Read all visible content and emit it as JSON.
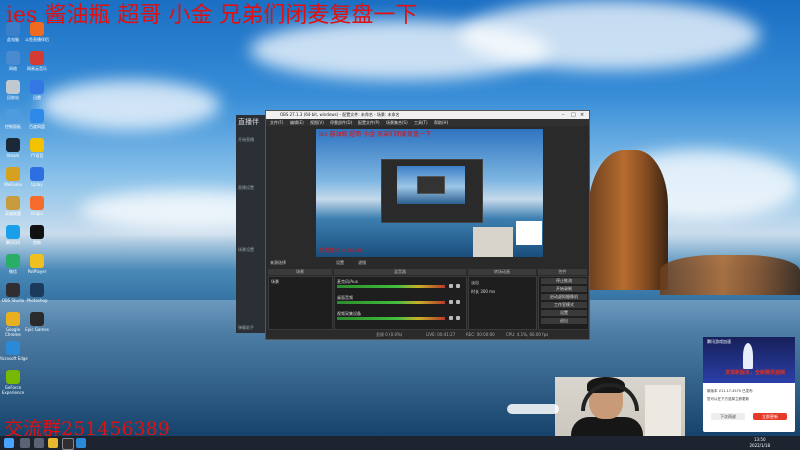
{
  "overlay": {
    "title": "ies 酱油瓶 超哥 小金 兄弟们闭麦复盘一下",
    "group": "交流群251456389"
  },
  "desktop_icons": [
    {
      "label": "此电脑",
      "color": "#3a7fc8"
    },
    {
      "label": "网络",
      "color": "#4a8ad0"
    },
    {
      "label": "回收站",
      "color": "#c0c8d0"
    },
    {
      "label": "控制面板",
      "color": "#4f9be0"
    },
    {
      "label": "Steam",
      "color": "#1b2838"
    },
    {
      "label": "WeGame",
      "color": "#d6a020"
    },
    {
      "label": "英雄联盟",
      "color": "#c89b3c"
    },
    {
      "label": "腾讯QQ",
      "color": "#1aa0e8"
    },
    {
      "label": "微信",
      "color": "#2aae67"
    },
    {
      "label": "OBS Studio",
      "color": "#302e31"
    },
    {
      "label": "Google Chrome",
      "color": "#e8b020"
    },
    {
      "label": "Microsoft Edge",
      "color": "#2b8ad8"
    },
    {
      "label": "GeForce Experience",
      "color": "#76b900"
    },
    {
      "label": "斗鱼直播伴侣",
      "color": "#f06a20"
    },
    {
      "label": "网易云音乐",
      "color": "#d43c33"
    },
    {
      "label": "迅雷",
      "color": "#3478e6"
    },
    {
      "label": "百度网盘",
      "color": "#2e8ae8"
    },
    {
      "label": "YY语音",
      "color": "#f2c200"
    },
    {
      "label": "Uplay",
      "color": "#2d6ee0"
    },
    {
      "label": "Origin",
      "color": "#f56c2d"
    },
    {
      "label": "剪映",
      "color": "#111111"
    },
    {
      "label": "PotPlayer",
      "color": "#f0c020"
    },
    {
      "label": "Photoshop",
      "color": "#1c3a5c"
    },
    {
      "label": "Epic Games",
      "color": "#2a2a2a"
    }
  ],
  "side_panel": {
    "logo": "直播伴",
    "items": [
      "开始直播",
      "直播设置",
      "场景设置",
      "弹幕助手"
    ]
  },
  "obs": {
    "title": "OBS 27.1.3 (64-bit, windows) - 配置文件: 未命名 - 场景: 未命名",
    "menu": [
      "文件(F)",
      "编辑(E)",
      "视图(V)",
      "停靠部件(D)",
      "配置文件(P)",
      "场景集合(S)",
      "工具(T)",
      "帮助(H)"
    ],
    "docks": [
      "来源选择",
      "设置",
      "滤镜"
    ],
    "headers": {
      "scenes": "场景",
      "sources": "来源",
      "mixer": "混音器",
      "transitions": "转场动画",
      "controls": "控件"
    },
    "scenes": [
      "场景"
    ],
    "mixer": [
      {
        "label": "麦克风/Aux"
      },
      {
        "label": "桌面音频"
      },
      {
        "label": "视频采集设备"
      }
    ],
    "transitions": [
      "淡出",
      "时长 300 ms"
    ],
    "controls": [
      "停止推流",
      "开始录制",
      "启动虚拟摄像机",
      "工作室模式",
      "设置",
      "退出"
    ],
    "status": {
      "dropped": "丢帧 0 (0.0%)",
      "live": "LIVE: 00:41:27",
      "rec": "REC: 00:00:00",
      "cpu": "CPU: 4.1%, 60.00 fps"
    }
  },
  "popup": {
    "title": "腾讯游戏加速",
    "headline": "发现新版本，全新腾讯视频",
    "lines": [
      "新版本 V11.17.4570 已发布",
      "您可以在下方选择立即更新"
    ],
    "later": "下次再说",
    "update": "立即更新"
  },
  "taskbar": {
    "time": "13:50",
    "date": "2022/1/18"
  }
}
